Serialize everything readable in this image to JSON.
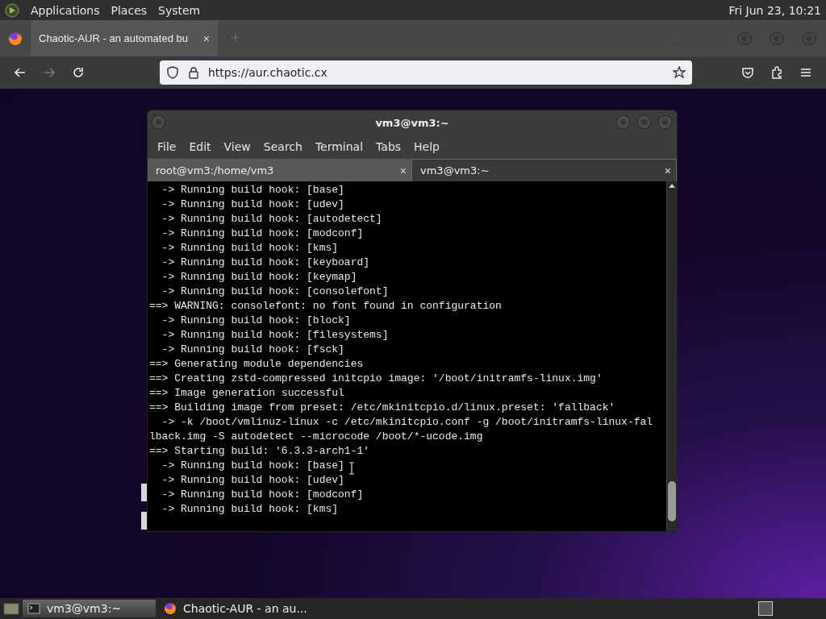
{
  "top_panel": {
    "menus": [
      "Applications",
      "Places",
      "System"
    ],
    "clock": "Fri Jun 23, 10:21"
  },
  "browser": {
    "tab": {
      "title": "Chaotic-AUR - an automated bu",
      "close": "×"
    },
    "new_tab": "+",
    "nav": {
      "back_disabled": false,
      "forward_disabled": true
    },
    "url": "https://aur.chaotic.cx"
  },
  "terminal": {
    "title": "vm3@vm3:~",
    "menus": [
      "File",
      "Edit",
      "View",
      "Search",
      "Terminal",
      "Tabs",
      "Help"
    ],
    "tabs": [
      {
        "label": "root@vm3:/home/vm3",
        "selected": false,
        "close": "×"
      },
      {
        "label": "vm3@vm3:~",
        "selected": true,
        "close": "×"
      }
    ],
    "lines": [
      "  -> Running build hook: [base]",
      "  -> Running build hook: [udev]",
      "  -> Running build hook: [autodetect]",
      "  -> Running build hook: [modconf]",
      "  -> Running build hook: [kms]",
      "  -> Running build hook: [keyboard]",
      "  -> Running build hook: [keymap]",
      "  -> Running build hook: [consolefont]",
      "==> WARNING: consolefont: no font found in configuration",
      "  -> Running build hook: [block]",
      "  -> Running build hook: [filesystems]",
      "  -> Running build hook: [fsck]",
      "==> Generating module dependencies",
      "==> Creating zstd-compressed initcpio image: '/boot/initramfs-linux.img'",
      "==> Image generation successful",
      "==> Building image from preset: /etc/mkinitcpio.d/linux.preset: 'fallback'",
      "  -> -k /boot/vmlinuz-linux -c /etc/mkinitcpio.conf -g /boot/initramfs-linux-fal",
      "lback.img -S autodetect --microcode /boot/*-ucode.img",
      "==> Starting build: '6.3.3-arch1-1'",
      "  -> Running build hook: [base]",
      "  -> Running build hook: [udev]",
      "  -> Running build hook: [modconf]",
      "  -> Running build hook: [kms]"
    ]
  },
  "taskbar": {
    "items": [
      {
        "label": "vm3@vm3:~",
        "kind": "terminal",
        "selected": true
      },
      {
        "label": "Chaotic-AUR - an au...",
        "kind": "browser",
        "selected": false
      }
    ]
  }
}
